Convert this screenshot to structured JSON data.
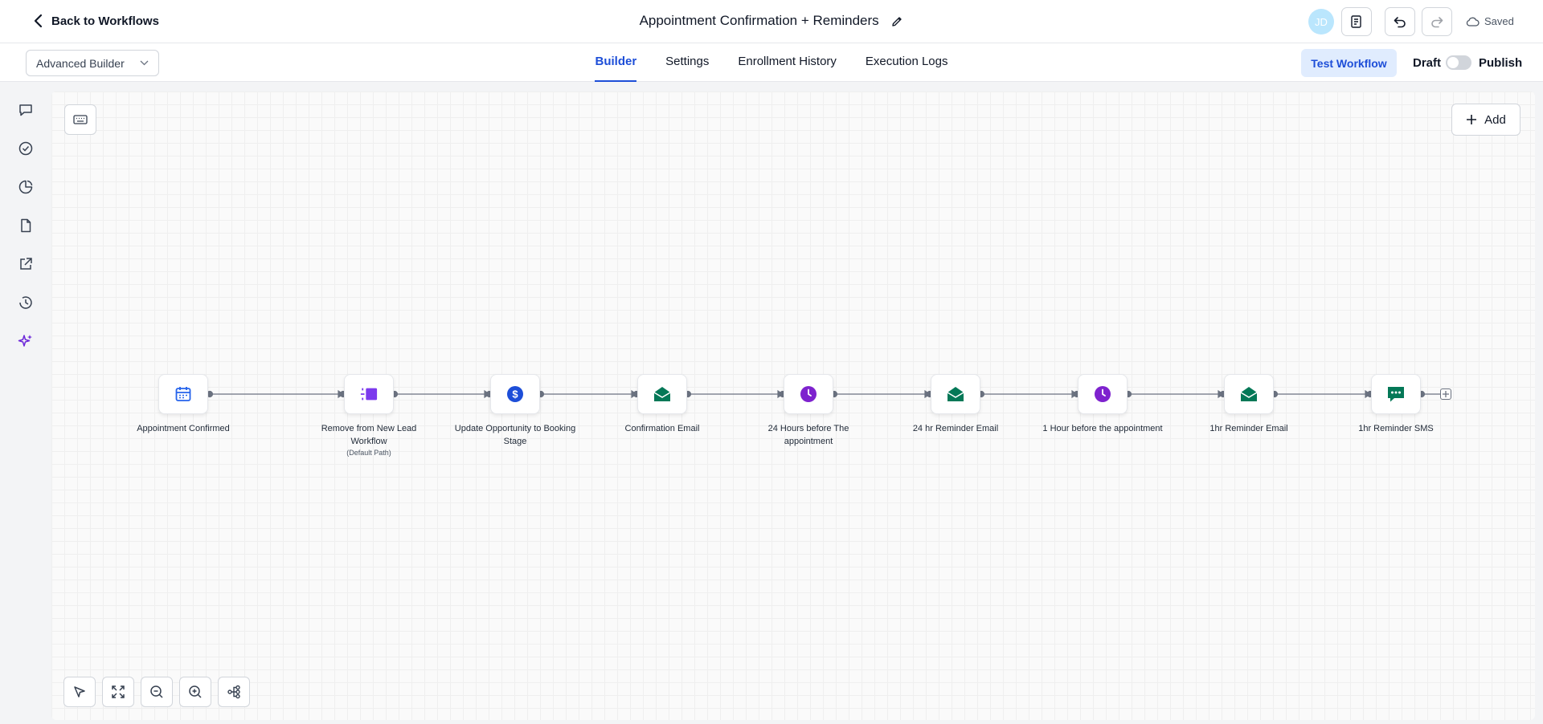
{
  "header": {
    "back_label": "Back to Workflows",
    "title": "Appointment Confirmation + Reminders",
    "avatar_initials": "JD",
    "saved_label": "Saved"
  },
  "subheader": {
    "builder_mode": "Advanced Builder",
    "tabs": [
      {
        "label": "Builder",
        "active": true
      },
      {
        "label": "Settings",
        "active": false
      },
      {
        "label": "Enrollment History",
        "active": false
      },
      {
        "label": "Execution Logs",
        "active": false
      }
    ],
    "test_label": "Test Workflow",
    "draft_label": "Draft",
    "publish_label": "Publish",
    "published": false
  },
  "sidebar": {
    "items": [
      {
        "icon": "chat-icon"
      },
      {
        "icon": "check-circle-icon"
      },
      {
        "icon": "pie-chart-icon"
      },
      {
        "icon": "document-icon"
      },
      {
        "icon": "external-link-icon"
      },
      {
        "icon": "history-icon"
      },
      {
        "icon": "sparkle-icon",
        "active": true
      }
    ]
  },
  "canvas": {
    "add_label": "Add",
    "nodes": [
      {
        "label": "Appointment Confirmed",
        "sub": "",
        "icon": "calendar-icon",
        "color": "#2563eb"
      },
      {
        "label": "Remove from New Lead Workflow",
        "sub": "(Default Path)",
        "icon": "remove-workflow-icon",
        "color": "#7c3aed"
      },
      {
        "label": "Update Opportunity to Booking Stage",
        "sub": "",
        "icon": "dollar-icon",
        "color": "#1d4ed8"
      },
      {
        "label": "Confirmation Email",
        "sub": "",
        "icon": "email-icon",
        "color": "#047857"
      },
      {
        "label": "24 Hours before The appointment",
        "sub": "",
        "icon": "clock-icon",
        "color": "#7e22ce"
      },
      {
        "label": "24 hr Reminder Email",
        "sub": "",
        "icon": "email-icon",
        "color": "#047857"
      },
      {
        "label": "1 Hour before the appointment",
        "sub": "",
        "icon": "clock-icon",
        "color": "#7e22ce"
      },
      {
        "label": "1hr Reminder Email",
        "sub": "",
        "icon": "email-icon",
        "color": "#047857"
      },
      {
        "label": "1hr Reminder SMS",
        "sub": "",
        "icon": "sms-icon",
        "color": "#047857"
      }
    ]
  },
  "toolbar": {
    "tools": [
      "pointer-icon",
      "fit-view-icon",
      "zoom-out-icon",
      "zoom-in-icon",
      "auto-layout-icon"
    ]
  }
}
